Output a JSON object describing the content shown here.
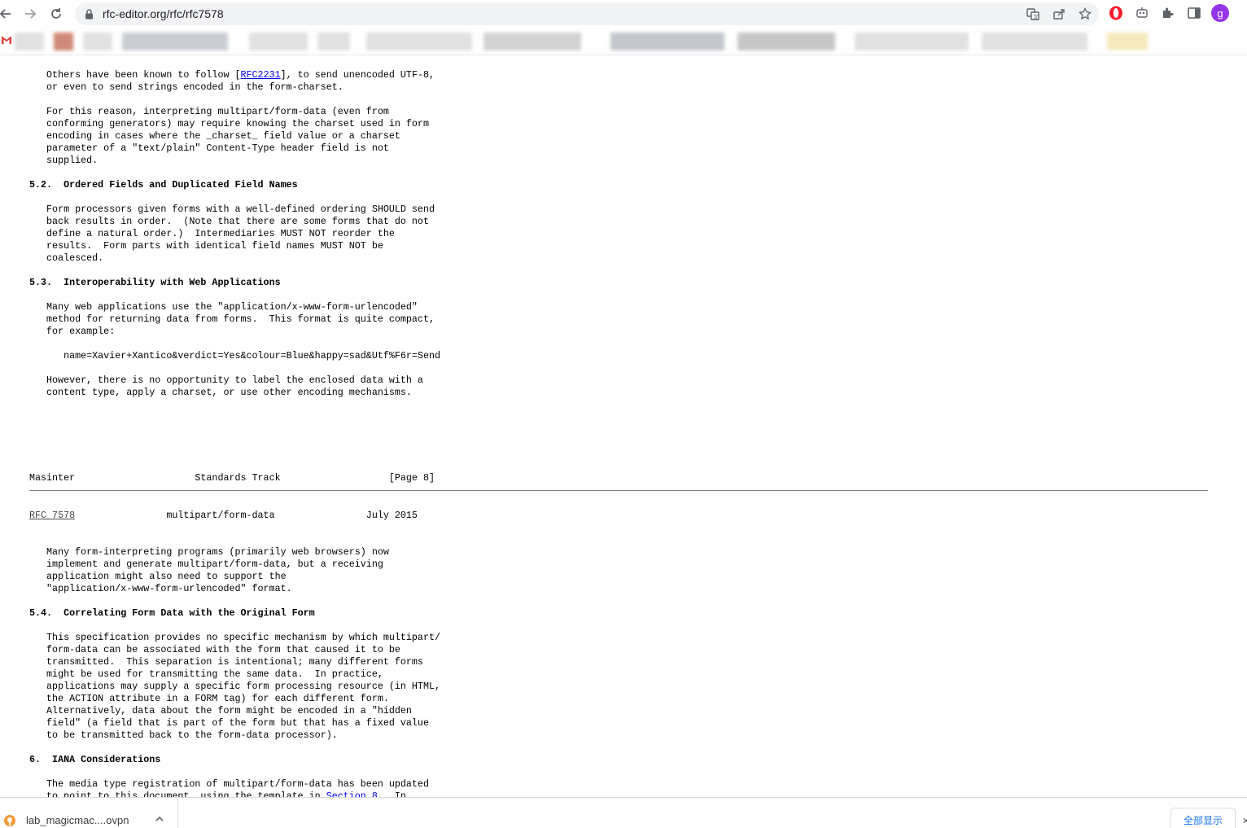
{
  "browser": {
    "url": "rfc-editor.org/rfc/rfc7578",
    "profile_initial": "g"
  },
  "page": {
    "para1_pre": "   Others have been known to follow [",
    "para1_link": "RFC2231",
    "para1_post": "], to send unencoded UTF-8,\n   or even to send strings encoded in the form-charset.",
    "para2": "   For this reason, interpreting multipart/form-data (even from\n   conforming generators) may require knowing the charset used in form\n   encoding in cases where the _charset_ field value or a charset\n   parameter of a \"text/plain\" Content-Type header field is not\n   supplied.",
    "sec52_title": "5.2.  Ordered Fields and Duplicated Field Names",
    "sec52_body": "   Form processors given forms with a well-defined ordering SHOULD send\n   back results in order.  (Note that there are some forms that do not\n   define a natural order.)  Intermediaries MUST NOT reorder the\n   results.  Form parts with identical field names MUST NOT be\n   coalesced.",
    "sec53_title": "5.3.  Interoperability with Web Applications",
    "sec53_body": "   Many web applications use the \"application/x-www-form-urlencoded\"\n   method for returning data from forms.  This format is quite compact,\n   for example:",
    "sec53_example": "      name=Xavier+Xantico&verdict=Yes&colour=Blue&happy=sad&Utf%F6r=Send",
    "sec53_body2": "   However, there is no opportunity to label the enclosed data with a\n   content type, apply a charset, or use other encoding mechanisms.",
    "footer_line": "Masinter                     Standards Track                   [Page 8]",
    "header_link": "RFC 7578",
    "header_rest": "                multipart/form-data                July 2015",
    "sec53_cont": "   Many form-interpreting programs (primarily web browsers) now\n   implement and generate multipart/form-data, but a receiving\n   application might also need to support the\n   \"application/x-www-form-urlencoded\" format.",
    "sec54_title": "5.4.  Correlating Form Data with the Original Form",
    "sec54_body": "   This specification provides no specific mechanism by which multipart/\n   form-data can be associated with the form that caused it to be\n   transmitted.  This separation is intentional; many different forms\n   might be used for transmitting the same data.  In practice,\n   applications may supply a specific form processing resource (in HTML,\n   the ACTION attribute in a FORM tag) for each different form.\n   Alternatively, data about the form might be encoded in a \"hidden\n   field\" (a field that is part of the form but that has a fixed value\n   to be transmitted back to the form-data processor).",
    "sec6_title": "6.  IANA Considerations",
    "sec6_body_pre": "   The media type registration of multipart/form-data has been updated\n   to point to this document, using the template in ",
    "sec6_link": "Section 8",
    "sec6_body_post": ".  In"
  },
  "download": {
    "file_name": "lab_magicmac....ovpn",
    "show_all_label": "全部显示"
  }
}
